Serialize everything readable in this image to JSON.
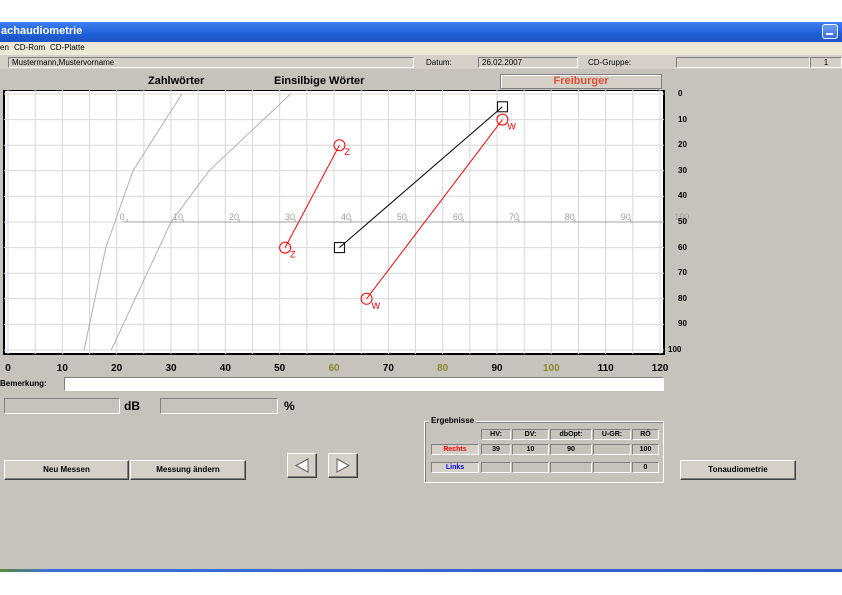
{
  "window": {
    "title": "achaudiometrie"
  },
  "menu": [
    "en",
    "CD-Rom",
    "CD-Platte"
  ],
  "info": {
    "patient": "Mustermann,Mustervorname",
    "date_label": "Datum:",
    "date": "26.02.2007",
    "cd_group_label": "CD-Gruppe:",
    "cd_group_value": "",
    "page": "1"
  },
  "headers": {
    "zahl": "Zahlwörter",
    "einsilbig": "Einsilbige Wörter",
    "test": "Freiburger"
  },
  "chart_data": {
    "type": "line",
    "x_axis": {
      "label": "dB",
      "ticks": [
        "0",
        "10",
        "20",
        "30",
        "40",
        "50",
        "60",
        "70",
        "80",
        "90",
        "100",
        "110",
        "120"
      ],
      "range": [
        0,
        120
      ]
    },
    "y_axis": {
      "label": "%",
      "ticks": [
        "0",
        "10",
        "20",
        "30",
        "40",
        "50",
        "60",
        "70",
        "80",
        "90",
        "100"
      ],
      "range": [
        0,
        100
      ],
      "inverted": true
    },
    "inner_scale_ticks": [
      "0",
      "10",
      "20",
      "30",
      "40",
      "50",
      "60",
      "70",
      "80",
      "90",
      "100"
    ],
    "highlight_colors": {
      "60": "#8a8a30",
      "80": "#8a8a30",
      "100": "#8a8a30"
    },
    "series": [
      {
        "color": "#ff0000",
        "marker": "Z",
        "points": [
          [
            51,
            60
          ],
          [
            61,
            20
          ]
        ]
      },
      {
        "color": "#ff0000",
        "marker": "W",
        "points": [
          [
            66,
            80
          ],
          [
            91,
            10
          ]
        ]
      },
      {
        "color": "#000000",
        "marker": "square",
        "points": [
          [
            61,
            60
          ],
          [
            91,
            5
          ]
        ]
      }
    ],
    "reference_curves": [
      {
        "color": "#b0b0b0",
        "points": [
          [
            14,
            100
          ],
          [
            18,
            60
          ],
          [
            23,
            30
          ],
          [
            32,
            0
          ]
        ]
      },
      {
        "color": "#b0b0b0",
        "points": [
          [
            19,
            100
          ],
          [
            30,
            50
          ],
          [
            37,
            30
          ],
          [
            52,
            0
          ]
        ]
      }
    ]
  },
  "bemerkung": {
    "label": "Bemerkung:",
    "value": ""
  },
  "units": {
    "db": "dB",
    "percent": "%"
  },
  "buttons": {
    "neu": "Neu Messen",
    "aendern": "Messung ändern",
    "tonaudio": "Tonaudiometrie"
  },
  "results": {
    "title": "Ergebnisse",
    "columns": [
      "HV:",
      "DV:",
      "dbOpt:",
      "U-GR:",
      "RÖ"
    ],
    "rows": [
      {
        "label": "Rechts",
        "color": "#ff0000",
        "values": [
          "39",
          "10",
          "90",
          "",
          "100"
        ]
      },
      {
        "label": "Links",
        "color": "#0000ff",
        "values": [
          "",
          "",
          "",
          "",
          "0"
        ]
      }
    ]
  }
}
